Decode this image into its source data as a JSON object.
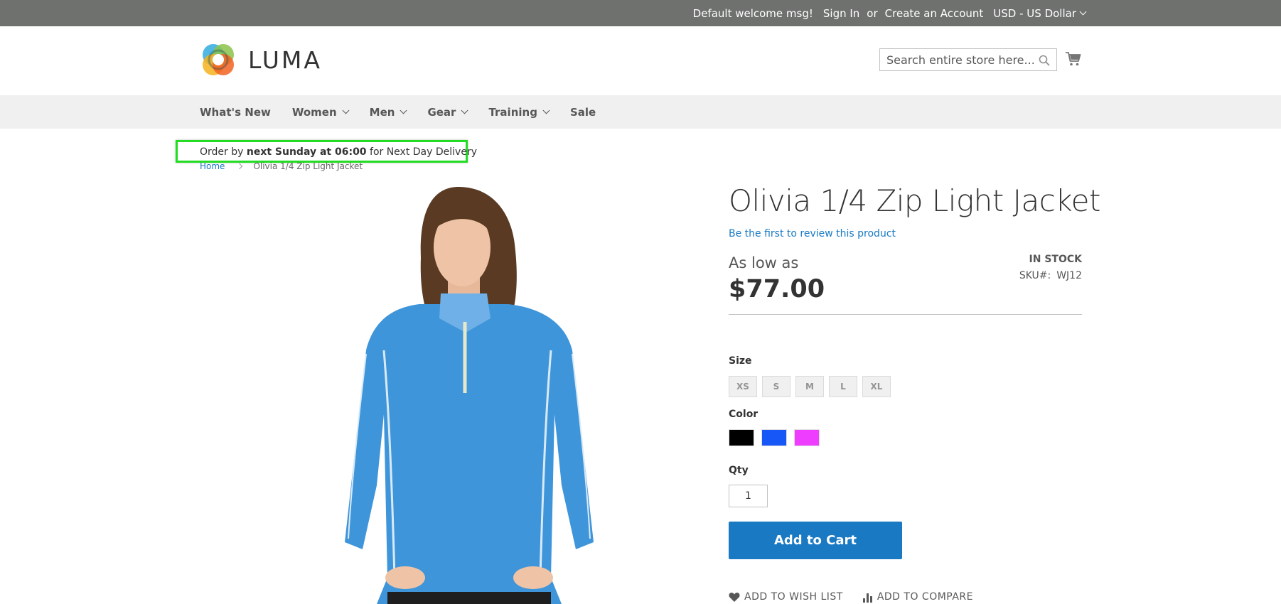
{
  "topbar": {
    "welcome": "Default welcome msg!",
    "sign_in": "Sign In",
    "or": "or",
    "create_account": "Create an Account",
    "currency": "USD - US Dollar"
  },
  "header": {
    "logo_text": "LUMA",
    "search_placeholder": "Search entire store here...",
    "search_icon": "search-icon",
    "cart_icon": "cart-icon"
  },
  "nav": {
    "items": [
      {
        "label": "What's New",
        "dropdown": false
      },
      {
        "label": "Women",
        "dropdown": true
      },
      {
        "label": "Men",
        "dropdown": true
      },
      {
        "label": "Gear",
        "dropdown": true
      },
      {
        "label": "Training",
        "dropdown": true
      },
      {
        "label": "Sale",
        "dropdown": false
      }
    ]
  },
  "notice": {
    "prefix": "Order by ",
    "emphasis": "next Sunday at 06:00",
    "suffix": " for Next Day Delivery",
    "highlight_color": "#22dd22"
  },
  "breadcrumb": {
    "home": "Home",
    "current": "Olivia 1/4 Zip Light Jacket"
  },
  "product": {
    "title": "Olivia 1/4 Zip Light Jacket",
    "review_link": "Be the first to review this product",
    "price_prefix": "As low as",
    "price": "$77.00",
    "stock": "IN STOCK",
    "sku_label": "SKU#:",
    "sku": "WJ12",
    "size_label": "Size",
    "sizes": [
      "XS",
      "S",
      "M",
      "L",
      "XL"
    ],
    "color_label": "Color",
    "colors": [
      {
        "name": "Black",
        "hex": "#000000"
      },
      {
        "name": "Blue",
        "hex": "#1857f7"
      },
      {
        "name": "Purple",
        "hex": "#ef3dff"
      }
    ],
    "qty_label": "Qty",
    "qty": "1",
    "add_to_cart": "Add to Cart",
    "wishlist": "Add to Wish List",
    "compare": "Add to Compare"
  },
  "colors": {
    "primary": "#1979c3",
    "topbar": "#6e716e",
    "nav_bg": "#f0f0f0",
    "jacket": "#3f95da"
  }
}
